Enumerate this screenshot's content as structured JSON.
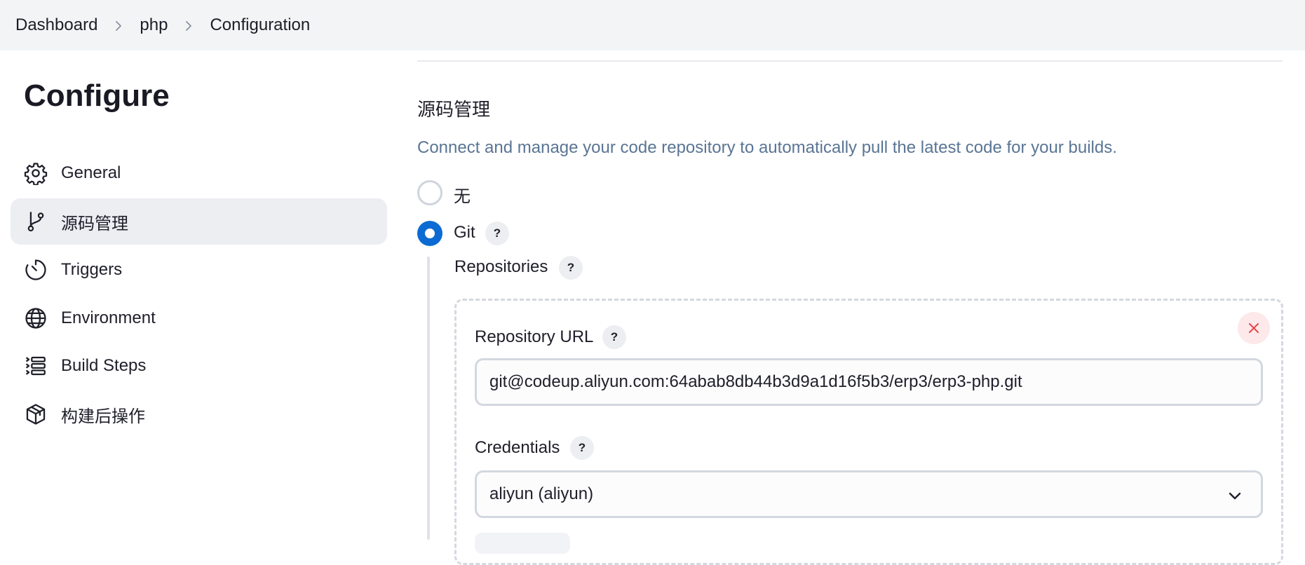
{
  "breadcrumb": {
    "items": [
      "Dashboard",
      "php",
      "Configuration"
    ]
  },
  "sidebar": {
    "title": "Configure",
    "items": [
      {
        "label": "General",
        "icon": "gear-icon"
      },
      {
        "label": "源码管理",
        "icon": "git-branch-icon",
        "active": true
      },
      {
        "label": "Triggers",
        "icon": "timer-icon"
      },
      {
        "label": "Environment",
        "icon": "globe-icon"
      },
      {
        "label": "Build Steps",
        "icon": "list-steps-icon"
      },
      {
        "label": "构建后操作",
        "icon": "package-icon"
      }
    ]
  },
  "scm": {
    "title": "源码管理",
    "description": "Connect and manage your code repository to automatically pull the latest code for your builds.",
    "options": [
      {
        "label": "无",
        "checked": false
      },
      {
        "label": "Git",
        "checked": true
      }
    ],
    "help_glyph": "?",
    "repositories_label": "Repositories",
    "repository_url_label": "Repository URL",
    "repository_url_value": "git@codeup.aliyun.com:64abab8db44b3d9a1d16f5b3/erp3/erp3-php.git",
    "credentials_label": "Credentials",
    "credentials_value": "aliyun (aliyun)"
  },
  "colors": {
    "accent": "#0b6bd3",
    "description": "#5a7594",
    "topbar_bg": "#f3f4f6",
    "active_bg": "#eceef2",
    "danger": "#e5484d"
  }
}
